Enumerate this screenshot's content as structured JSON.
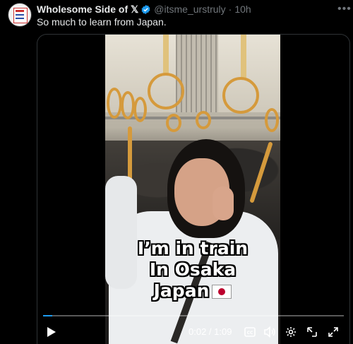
{
  "post": {
    "author_name": "Wholesome Side of 𝕏",
    "handle": "@itsme_urstruly",
    "separator": "·",
    "time": "10h",
    "text": "So much to learn from Japan.",
    "more_icon": "more-icon"
  },
  "video": {
    "caption_line1": "I’m in train",
    "caption_line2": "In Osaka",
    "caption_line3": "Japan",
    "progress_fraction": 0.03,
    "time_display": "0:02 / 1:09",
    "controls": [
      "play-icon",
      "captions-icon",
      "volume-icon",
      "settings-icon",
      "minimize-icon",
      "fullscreen-icon"
    ]
  },
  "colors": {
    "background": "#000000",
    "text": "#e7e9ea",
    "muted": "#71767b",
    "verified": "#1d9bf0",
    "accent": "#1d9bf0"
  }
}
